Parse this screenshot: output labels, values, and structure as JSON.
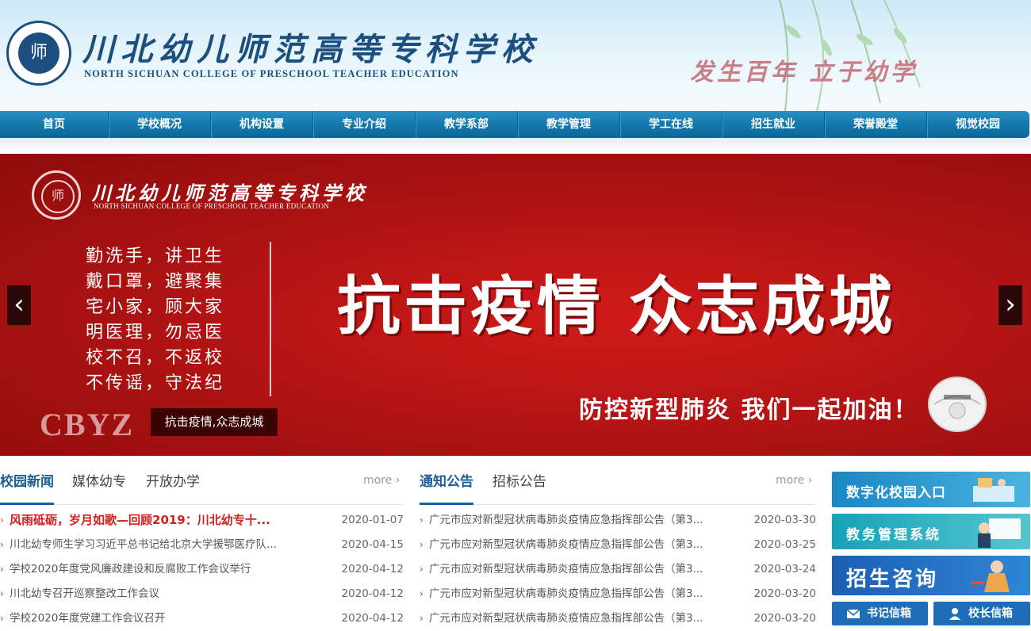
{
  "header": {
    "school_name_cn": "川北幼儿师范高等专科学校",
    "school_name_en": "NORTH SICHUAN COLLEGE OF PRESCHOOL TEACHER EDUCATION",
    "slogan": "发生百年  立于幼学",
    "seal_char": "师"
  },
  "nav": {
    "items": [
      "首页",
      "学校概况",
      "机构设置",
      "专业介绍",
      "教学系部",
      "教学管理",
      "学工在线",
      "招生就业",
      "荣誉殿堂",
      "视觉校园"
    ]
  },
  "banner": {
    "school_name_cn": "川北幼儿师范高等专科学校",
    "school_name_en": "NORTH SICHUAN COLLEGE OF PRESCHOOL TEACHER EDUCATION",
    "poem": [
      "勤洗手，讲卫生",
      "戴口罩，避聚集",
      "宅小家，顾大家",
      "明医理，勿忌医",
      "校不召，不返校",
      "不传谣，守法纪"
    ],
    "headline": "抗击疫情 众志成城",
    "subline": "防控新型肺炎 我们一起加油！",
    "watermark": "CBYZ",
    "caption": "抗击疫情,众志成城",
    "prev_icon": "chevron-left",
    "next_icon": "chevron-right",
    "colors": {
      "background": "#b31414"
    }
  },
  "news": {
    "tabs": [
      "校园新闻",
      "媒体幼专",
      "开放办学"
    ],
    "more": "more",
    "items": [
      {
        "title": "风雨砥砺，岁月如歌—回顾2019：川北幼专十...",
        "date": "2020-01-07"
      },
      {
        "title": "川北幼专师生学习习近平总书记给北京大学援鄂医疗队...",
        "date": "2020-04-15"
      },
      {
        "title": "学校2020年度党风廉政建设和反腐败工作会议举行",
        "date": "2020-04-12"
      },
      {
        "title": "川北幼专召开巡察整改工作会议",
        "date": "2020-04-12"
      },
      {
        "title": "学校2020年度党建工作会议召开",
        "date": "2020-04-12"
      }
    ]
  },
  "notices": {
    "tabs": [
      "通知公告",
      "招标公告"
    ],
    "more": "more",
    "items": [
      {
        "title": "广元市应对新型冠状病毒肺炎疫情应急指挥部公告（第3...",
        "date": "2020-03-30"
      },
      {
        "title": "广元市应对新型冠状病毒肺炎疫情应急指挥部公告（第3...",
        "date": "2020-03-25"
      },
      {
        "title": "广元市应对新型冠状病毒肺炎疫情应急指挥部公告（第3...",
        "date": "2020-03-24"
      },
      {
        "title": "广元市应对新型冠状病毒肺炎疫情应急指挥部公告（第3...",
        "date": "2020-03-20"
      },
      {
        "title": "广元市应对新型冠状病毒肺炎疫情应急指挥部公告（第3...",
        "date": "2020-03-20"
      }
    ]
  },
  "sidebar": {
    "digital_campus": "数字化校园入口",
    "academic_system": "教务管理系统",
    "admissions": "招生咨询",
    "secretary_mail": "书记信箱",
    "president_mail": "校长信箱"
  },
  "colors": {
    "primary": "#1c5f99",
    "nav": "#1478ac",
    "highlight": "#d41f1f"
  }
}
